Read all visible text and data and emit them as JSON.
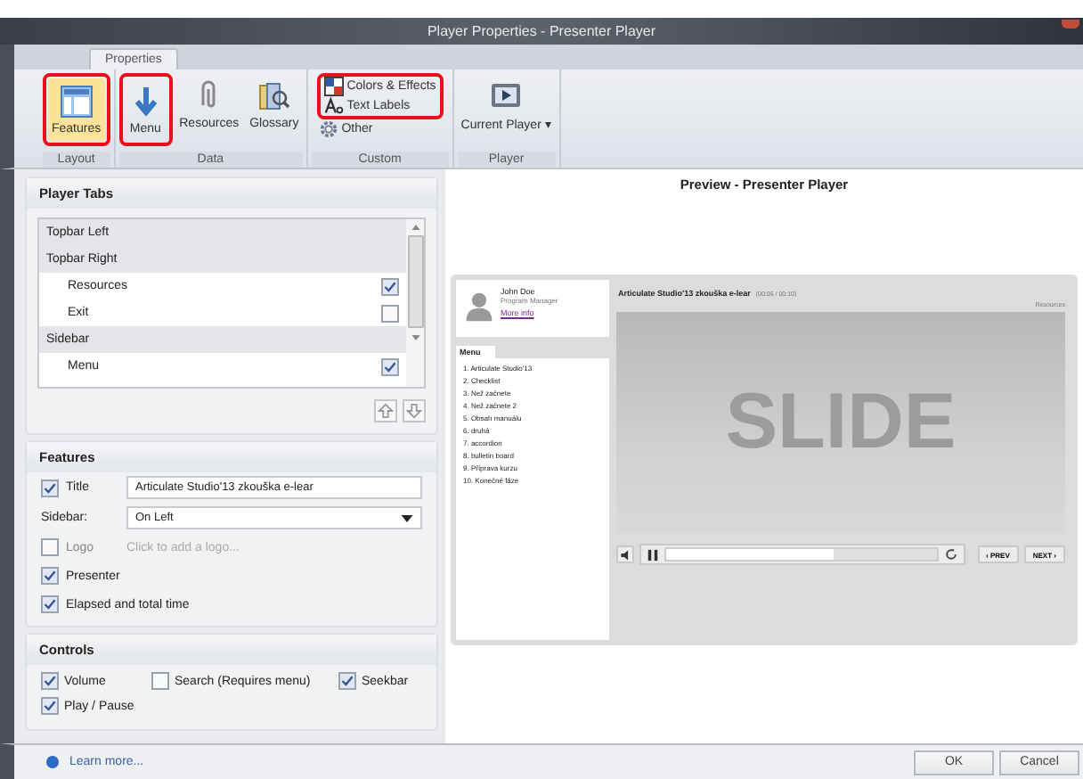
{
  "window": {
    "title": "Player Properties - Presenter Player"
  },
  "ribbon_tabs": [
    {
      "label": "Properties",
      "selected": true
    }
  ],
  "ribbon_groups": [
    {
      "label": "Layout",
      "items": [
        {
          "label": "Features",
          "selected": true,
          "highlighted": true
        }
      ]
    },
    {
      "label": "Data",
      "items": [
        {
          "label": "Menu",
          "selected": false,
          "highlighted": true
        },
        {
          "label": "Resources",
          "selected": false,
          "highlighted": false
        },
        {
          "label": "Glossary",
          "selected": false,
          "highlighted": false
        }
      ]
    },
    {
      "label": "Custom",
      "small_items": [
        {
          "label": "Colors & Effects",
          "highlighted": true
        },
        {
          "label": "Text Labels",
          "highlighted": true
        },
        {
          "label": "Other",
          "highlighted": false
        }
      ]
    },
    {
      "label": "Player",
      "items": [
        {
          "label": "Current Player ▾",
          "selected": false,
          "highlighted": false
        }
      ]
    }
  ],
  "player_tabs": {
    "title": "Player Tabs",
    "rows": [
      {
        "kind": "group",
        "label": "Topbar Left"
      },
      {
        "kind": "group",
        "label": "Topbar Right"
      },
      {
        "kind": "item",
        "label": "Resources",
        "checked": true
      },
      {
        "kind": "item",
        "label": "Exit",
        "checked": false
      },
      {
        "kind": "group",
        "label": "Sidebar"
      },
      {
        "kind": "item",
        "label": "Menu",
        "checked": true
      }
    ]
  },
  "features": {
    "title": "Features",
    "rows": [
      {
        "kind": "text",
        "label": "Title",
        "checked": true,
        "value": "Articulate Studio'13 zkouška e-lear"
      },
      {
        "kind": "select",
        "label": "Sidebar:",
        "value": "On Left"
      },
      {
        "kind": "link",
        "label": "Logo",
        "checked": false,
        "placeholder": "Click to add a logo..."
      },
      {
        "kind": "check",
        "label": "Presenter",
        "checked": true
      },
      {
        "kind": "check",
        "label": "Elapsed and total time",
        "checked": true
      }
    ]
  },
  "controls": {
    "title": "Controls",
    "items": [
      {
        "label": "Volume",
        "checked": true
      },
      {
        "label": "Search (Requires menu)",
        "checked": false
      },
      {
        "label": "Seekbar",
        "checked": true
      },
      {
        "label": "Play / Pause",
        "checked": true
      }
    ]
  },
  "learn_more": "Learn more...",
  "preview": {
    "title": "Preview - Presenter Player",
    "presenter": {
      "name": "John Doe",
      "role": "Program Manager",
      "link": "More info"
    },
    "menu_tab": "Menu",
    "menu_items": [
      "1. Articulate Studio'13",
      "2. Checklist",
      "3. Než začnete",
      "4. Než začnete 2",
      "5. Obsah manuálu",
      "6. druhá",
      "7. accordion",
      "8. bulletin board",
      "9. Příprava kurzu",
      "10. Konečné fáze"
    ],
    "course_title": "Articulate Studio'13 zkouška e-lear",
    "time": "(00:06 / 00:10)",
    "resources": "Resources",
    "slide_text": "SLIDE",
    "seek": {
      "level": 0.62
    },
    "prev": "‹ PREV",
    "next": "NEXT ›"
  },
  "buttons": [
    "OK",
    "Cancel"
  ]
}
